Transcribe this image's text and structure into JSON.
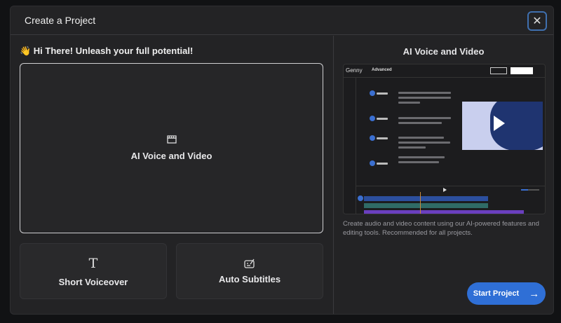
{
  "dialog": {
    "title": "Create a Project",
    "close_icon": "close-icon"
  },
  "left": {
    "greeting": "👋 Hi There! Unleash your full potential!",
    "options": [
      {
        "label": "AI Voice and Video",
        "icon": "clapperboard-icon"
      },
      {
        "label": "Short Voiceover",
        "icon": "text-T-icon"
      },
      {
        "label": "Auto Subtitles",
        "icon": "subtitles-icon"
      }
    ]
  },
  "right": {
    "title": "AI Voice and Video",
    "preview": {
      "brand": "Genny",
      "mode": "Advanced"
    },
    "description": "Create audio and video content using our AI-powered features and editing tools. Recommended for all projects.",
    "start_label": "Start Project"
  },
  "colors": {
    "accent": "#2f6fd6",
    "track1": "#2c4f9e",
    "track2": "#2f6b66",
    "track3": "#6a3fbf"
  }
}
